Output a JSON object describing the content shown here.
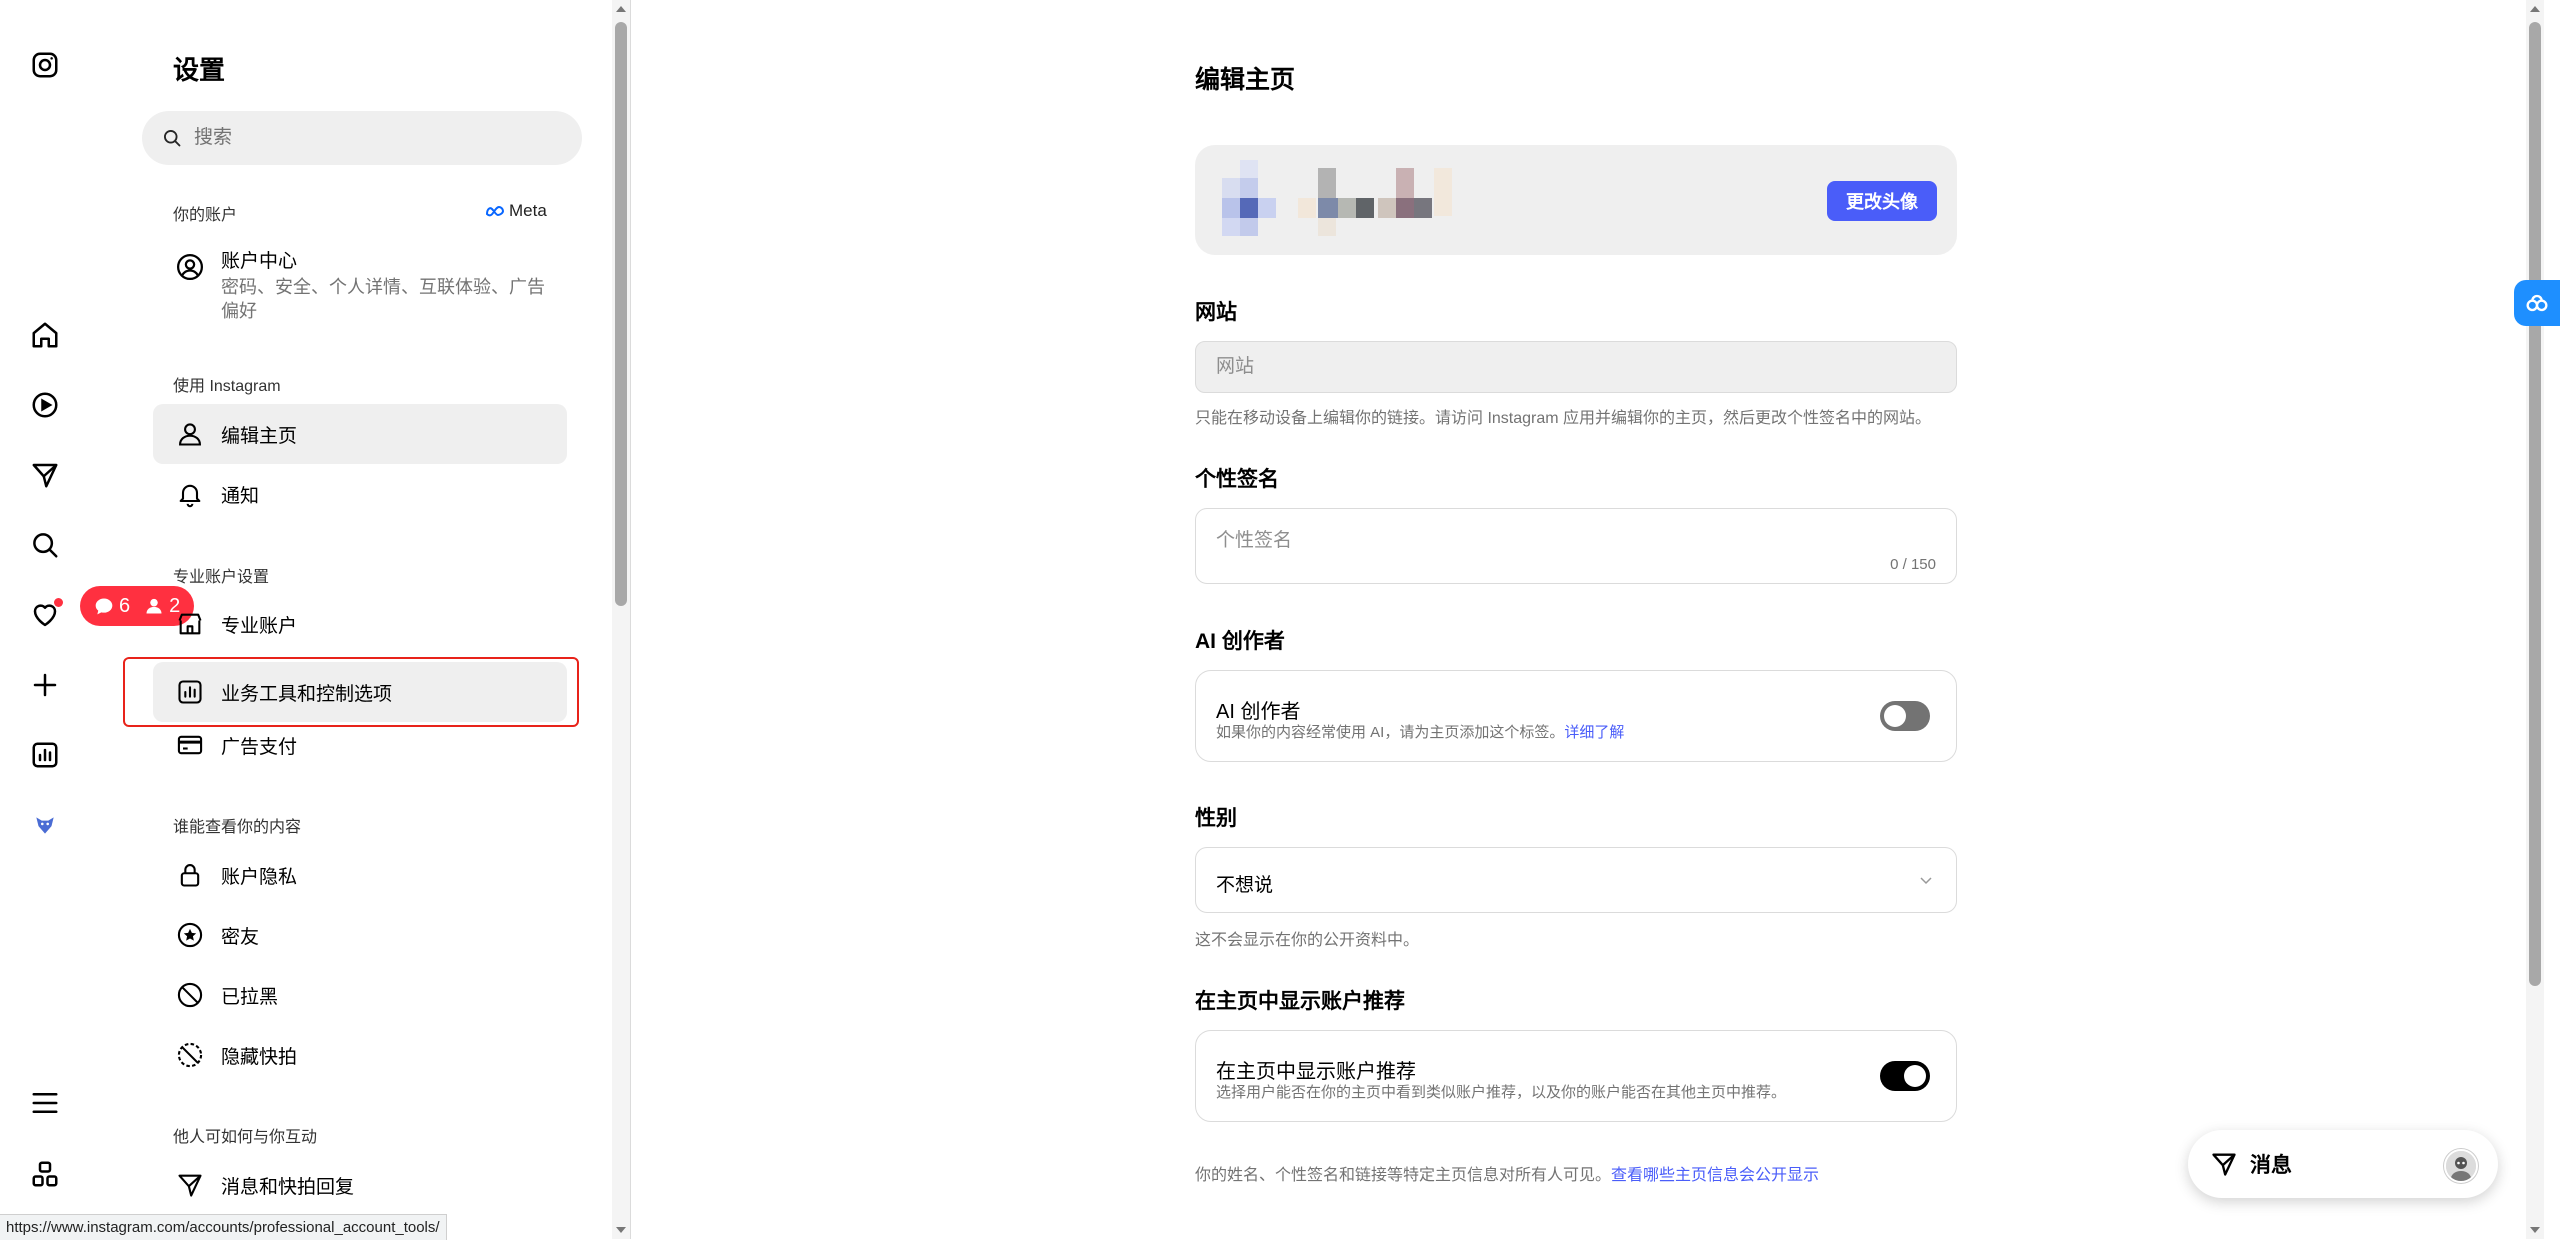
{
  "settings": {
    "title": "设置",
    "search_placeholder": "搜索",
    "your_account_label": "你的账户",
    "meta_label": "Meta",
    "account_center": {
      "title": "账户中心",
      "subtitle": "密码、安全、个人详情、互联体验、广告偏好"
    },
    "use_instagram_label": "使用 Instagram",
    "edit_profile": "编辑主页",
    "notifications": "通知",
    "professional_label": "专业账户设置",
    "professional_account": "专业账户",
    "business_tools": "业务工具和控制选项",
    "ad_payments": "广告支付",
    "who_can_see_label": "谁能查看你的内容",
    "account_privacy": "账户隐私",
    "close_friends": "密友",
    "blocked": "已拉黑",
    "hide_story": "隐藏快拍",
    "interactions_label": "他人可如何与你互动",
    "messages_replies": "消息和快拍回复"
  },
  "notifications_pill": {
    "comments": "6",
    "follows": "2"
  },
  "main": {
    "title": "编辑主页",
    "change_avatar": "更改头像",
    "website_title": "网站",
    "website_placeholder": "网站",
    "website_hint": "只能在移动设备上编辑你的链接。请访问 Instagram 应用并编辑你的主页，然后更改个性签名中的网站。",
    "bio_title": "个性签名",
    "bio_placeholder": "个性签名",
    "bio_count": "0 / 150",
    "ai_section_title": "AI 创作者",
    "ai_card_title": "AI 创作者",
    "ai_card_sub": "如果你的内容经常使用 AI，请为主页添加这个标签。",
    "ai_learn_more": "详细了解",
    "ai_toggle_on": false,
    "gender_title": "性别",
    "gender_value": "不想说",
    "gender_hint": "这不会显示在你的公开资料中。",
    "recommend_section_title": "在主页中显示账户推荐",
    "recommend_card_title": "在主页中显示账户推荐",
    "recommend_card_sub": "选择用户能否在你的主页中看到类似账户推荐，以及你的账户能否在其他主页中推荐。",
    "recommend_toggle_on": true,
    "footer_note": "你的姓名、个性签名和链接等特定主页信息对所有人可见。",
    "footer_link": "查看哪些主页信息会公开显示"
  },
  "messages_dock": {
    "label": "消息"
  },
  "status_url": "https://www.instagram.com/accounts/professional_account_tools/",
  "colors": {
    "accent": "#4a5df9",
    "notification_red": "#ff3040",
    "highlight_box": "#e8231a"
  }
}
